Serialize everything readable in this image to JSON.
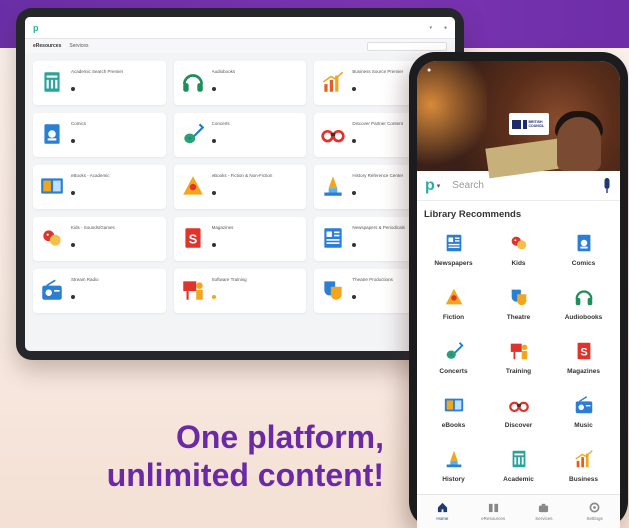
{
  "tagline": {
    "line1": "One platform,",
    "line2": "unlimited content!"
  },
  "phone": {
    "search_placeholder": "Search",
    "section_title": "Library Recommends",
    "categories": [
      {
        "label": "Newspapers",
        "icon": "newspaper-icon"
      },
      {
        "label": "Kids",
        "icon": "kids-icon"
      },
      {
        "label": "Comics",
        "icon": "comics-icon"
      },
      {
        "label": "Fiction",
        "icon": "fiction-icon"
      },
      {
        "label": "Theatre",
        "icon": "theatre-icon"
      },
      {
        "label": "Audiobooks",
        "icon": "headphones-icon"
      },
      {
        "label": "Concerts",
        "icon": "guitar-icon"
      },
      {
        "label": "Training",
        "icon": "training-icon"
      },
      {
        "label": "Magazines",
        "icon": "magazine-icon"
      },
      {
        "label": "eBooks",
        "icon": "ebook-icon"
      },
      {
        "label": "Discover",
        "icon": "binoculars-icon"
      },
      {
        "label": "Music",
        "icon": "radio-icon"
      },
      {
        "label": "History",
        "icon": "history-icon"
      },
      {
        "label": "Academic",
        "icon": "academic-icon"
      },
      {
        "label": "Business",
        "icon": "business-chart-icon"
      }
    ],
    "nav": [
      {
        "label": "Home",
        "icon": "home-icon"
      },
      {
        "label": "eResources",
        "icon": "eresources-icon"
      },
      {
        "label": "Services",
        "icon": "services-icon"
      },
      {
        "label": "Settings",
        "icon": "settings-icon"
      }
    ],
    "colors": {
      "brand": "#27b09f",
      "accent_purple": "#6a2aa5"
    }
  },
  "tablet": {
    "tabs": [
      "eResources",
      "Services"
    ],
    "cards": [
      {
        "title": "Academic Search Premier",
        "icon": "academic-icon"
      },
      {
        "title": "Audiobooks",
        "icon": "headphones-icon"
      },
      {
        "title": "Business Source Premier",
        "icon": "business-chart-icon"
      },
      {
        "title": "Comics",
        "icon": "comics-icon"
      },
      {
        "title": "Concerts",
        "icon": "guitar-icon"
      },
      {
        "title": "Discover Partner Content",
        "icon": "binoculars-icon"
      },
      {
        "title": "eBooks - Academic",
        "icon": "ebook-icon"
      },
      {
        "title": "eBooks - Fiction & Non-Fiction",
        "icon": "fiction-icon"
      },
      {
        "title": "History Reference Center",
        "icon": "history-icon"
      },
      {
        "title": "Kids - Sounds/Games",
        "icon": "kids-icon"
      },
      {
        "title": "Magazines",
        "icon": "magazine-icon"
      },
      {
        "title": "Newspapers & Periodicals",
        "icon": "newspaper-icon"
      },
      {
        "title": "Stream Radio",
        "icon": "radio-icon"
      },
      {
        "title": "Software Training",
        "icon": "training-icon"
      },
      {
        "title": "Theatre Productions",
        "icon": "theatre-icon"
      }
    ]
  }
}
